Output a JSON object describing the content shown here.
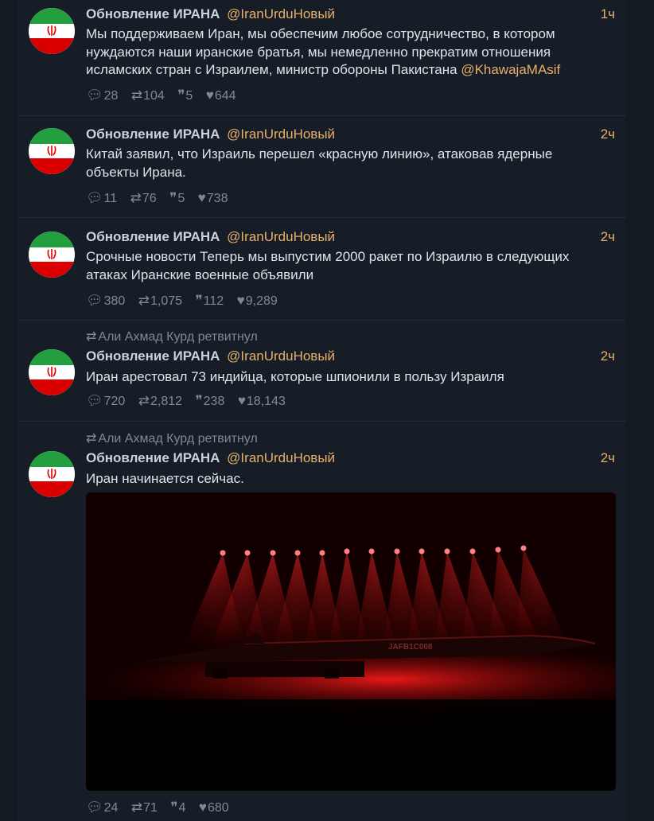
{
  "tweets": [
    {
      "retweeted_by": "",
      "name": "Обновление ИРАНА",
      "handle": "@IranUrduНовый",
      "time": "1ч",
      "text": "Мы поддерживаем Иран, мы обеспечим любое сотрудничество, в котором нуждаются наши иранские братья, мы немедленно прекратим отношения исламских стран с Израилем, министр обороны Пакистана ",
      "mention": "@KhawajaMAsif",
      "replies": "28",
      "retweets": "104",
      "quotes": "5",
      "likes": "644"
    },
    {
      "retweeted_by": "",
      "name": "Обновление ИРАНА",
      "handle": "@IranUrduНовый",
      "time": "2ч",
      "text": "Китай заявил, что Израиль перешел «красную линию», атаковав ядерные объекты Ирана.",
      "replies": "11",
      "retweets": "76",
      "quotes": "5",
      "likes": "738"
    },
    {
      "retweeted_by": "",
      "name": "Обновление ИРАНА",
      "handle": "@IranUrduНовый",
      "time": "2ч",
      "text": "Срочные новости Теперь мы выпустим 2000 ракет по Израилю в следующих атаках Иранские военные объявили",
      "replies": "380",
      "retweets": "1,075",
      "quotes": "112",
      "likes": "9,289"
    },
    {
      "retweeted_by": "Али Ахмад Курд ретвитнул",
      "name": "Обновление ИРАНА",
      "handle": "@IranUrduНовый",
      "time": "2ч",
      "text": "Иран арестовал 73 индийца, которые шпионили в пользу Израиля",
      "replies": "720",
      "retweets": "2,812",
      "quotes": "238",
      "likes": "18,143"
    },
    {
      "retweeted_by": "Али Ахмад Курд ретвитнул",
      "name": "Обновление ИРАНА",
      "handle": "@IranUrduНовый",
      "time": "2ч",
      "text": "Иран начинается сейчас.",
      "media_caption": "JAFB1C008",
      "replies": "24",
      "retweets": "71",
      "quotes": "4",
      "likes": "680"
    }
  ],
  "icons": {
    "reply": "speech-bubble-icon",
    "retweet": "retweet-arrows-icon",
    "quote": "quote-marks-icon",
    "like": "heart-icon"
  },
  "colors": {
    "background": "#161d27",
    "accent": "#e8b06b",
    "text": "#dfe4ea",
    "muted": "#7f8a96",
    "flag_green": "#239f40",
    "flag_red": "#da0000"
  }
}
